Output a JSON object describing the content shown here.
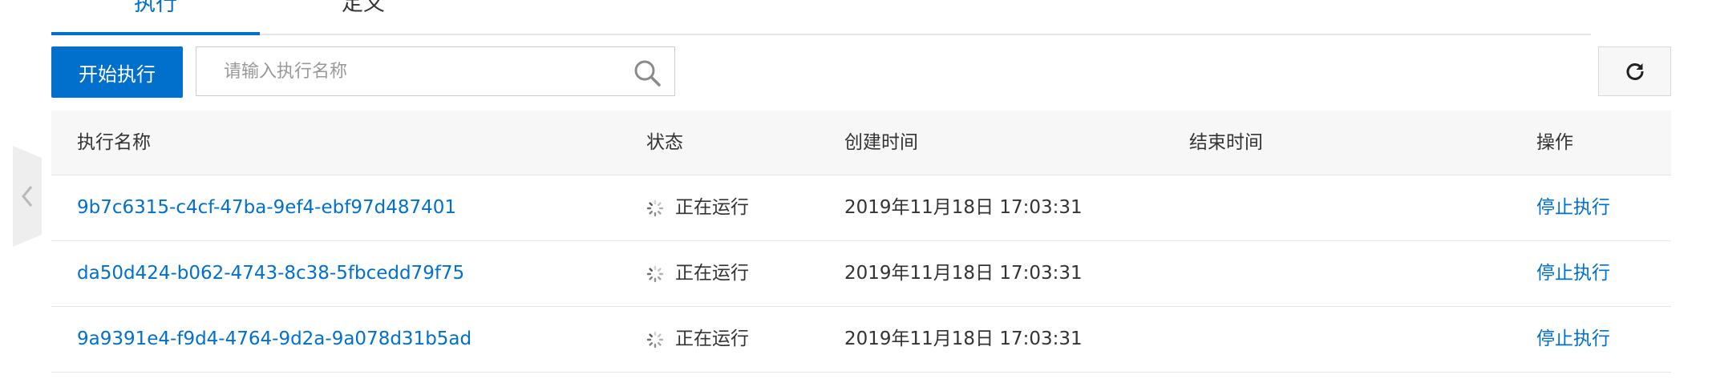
{
  "tabs": [
    {
      "label": "执行",
      "active": true
    },
    {
      "label": "定义",
      "active": false
    }
  ],
  "toolbar": {
    "start_label": "开始执行",
    "search_placeholder": "请输入执行名称",
    "search_value": ""
  },
  "table": {
    "columns": [
      "执行名称",
      "状态",
      "创建时间",
      "结束时间",
      "操作"
    ],
    "rows": [
      {
        "name": "9b7c6315-c4cf-47ba-9ef4-ebf97d487401",
        "status": "正在运行",
        "created": "2019年11月18日 17:03:31",
        "ended": "",
        "action": "停止执行"
      },
      {
        "name": "da50d424-b062-4743-8c38-5fbcedd79f75",
        "status": "正在运行",
        "created": "2019年11月18日 17:03:31",
        "ended": "",
        "action": "停止执行"
      },
      {
        "name": "9a9391e4-f9d4-4764-9d2a-9a078d31b5ad",
        "status": "正在运行",
        "created": "2019年11月18日 17:03:31",
        "ended": "",
        "action": "停止执行"
      }
    ]
  },
  "icons": {
    "collapse": "chevron-left-icon",
    "search": "search-icon",
    "refresh": "refresh-icon",
    "status": "spinner-icon"
  },
  "colors": {
    "primary": "#0070cc",
    "header_bg": "#f7f7f7",
    "border": "#e6e6e6"
  }
}
